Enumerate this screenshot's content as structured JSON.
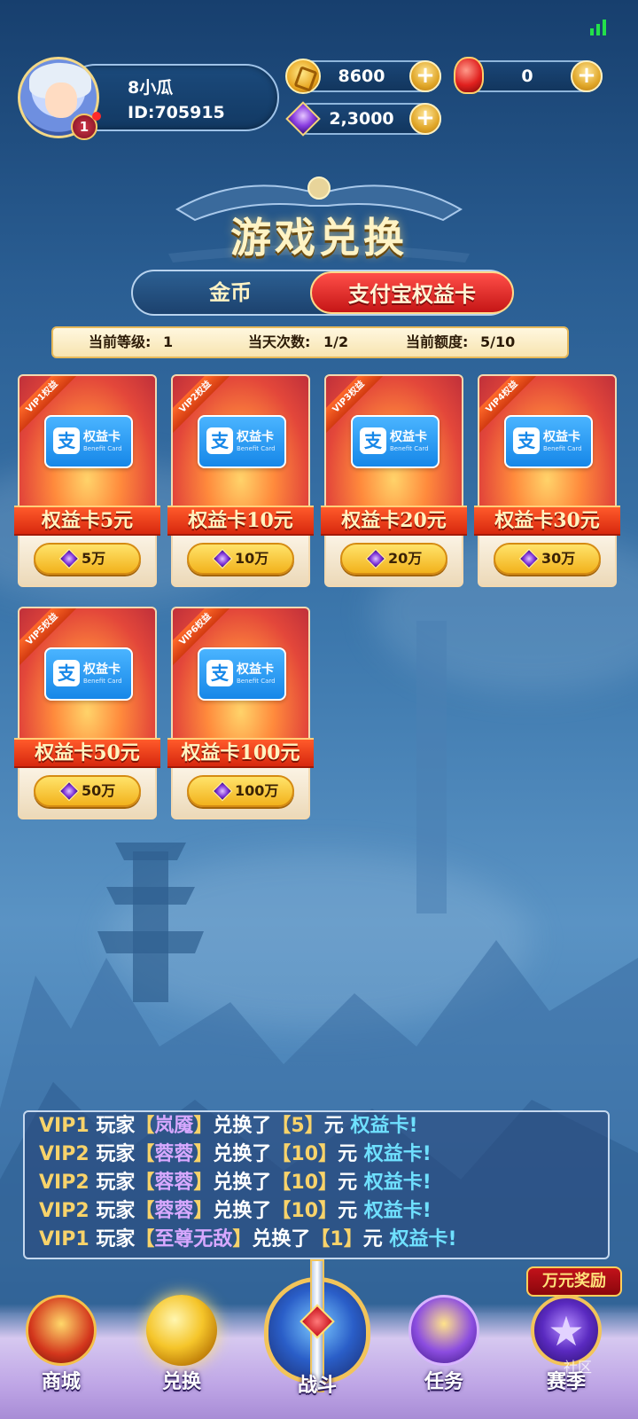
{
  "player": {
    "name": "8小瓜",
    "id": "ID:705915",
    "level": "1"
  },
  "currency": {
    "gold": "8600",
    "ruby": "0",
    "gem": "2,3000"
  },
  "title": "游戏兑换",
  "tabs": [
    {
      "label": "金币",
      "active": false
    },
    {
      "label": "支付宝权益卡",
      "active": true
    }
  ],
  "info": {
    "level_label": "当前等级:",
    "level_value": "1",
    "times_label": "当天次数:",
    "times_value": "1/2",
    "quota_label": "当前额度:",
    "quota_value": "5/10"
  },
  "card_common": {
    "zhi": "支",
    "card_title": "权益卡",
    "card_subtitle": "Benefit Card"
  },
  "cards": [
    {
      "vip": "VIP1权益",
      "name": "权益卡5元",
      "price": "5万"
    },
    {
      "vip": "VIP2权益",
      "name": "权益卡10元",
      "price": "10万"
    },
    {
      "vip": "VIP3权益",
      "name": "权益卡20元",
      "price": "20万"
    },
    {
      "vip": "VIP4权益",
      "name": "权益卡30元",
      "price": "30万"
    },
    {
      "vip": "VIP5权益",
      "name": "权益卡50元",
      "price": "50万"
    },
    {
      "vip": "VIP6权益",
      "name": "权益卡100元",
      "price": "100万"
    }
  ],
  "broadcast": [
    {
      "vip": "VIP1",
      "player": "玩家",
      "name": "岚魇",
      "verb": "兑换了",
      "amount": "5",
      "unit": "元",
      "item": "权益卡!"
    },
    {
      "vip": "VIP2",
      "player": "玩家",
      "name": "蓉蓉",
      "verb": "兑换了",
      "amount": "10",
      "unit": "元",
      "item": "权益卡!"
    },
    {
      "vip": "VIP2",
      "player": "玩家",
      "name": "蓉蓉",
      "verb": "兑换了",
      "amount": "10",
      "unit": "元",
      "item": "权益卡!"
    },
    {
      "vip": "VIP2",
      "player": "玩家",
      "name": "蓉蓉",
      "verb": "兑换了",
      "amount": "10",
      "unit": "元",
      "item": "权益卡!"
    },
    {
      "vip": "VIP1",
      "player": "玩家",
      "name": "至尊无敌",
      "verb": "兑换了",
      "amount": "1",
      "unit": "元",
      "item": "权益卡!"
    }
  ],
  "reward_badge": "万元奖励",
  "nav": {
    "shop": "商城",
    "exchange": "兑换",
    "battle": "战斗",
    "task": "任务",
    "season": "赛季"
  },
  "watermark": "社区"
}
